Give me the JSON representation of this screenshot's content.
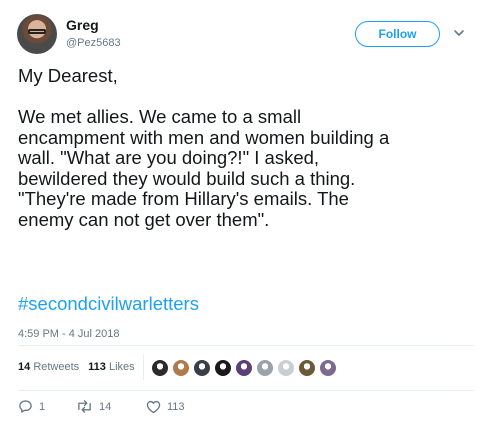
{
  "author": {
    "name": "Greg",
    "handle": "@Pez5683"
  },
  "follow_label": "Follow",
  "tweet": {
    "text": "My Dearest,\n\nWe met allies. We came to a small\nencampment with men and women building a\nwall. \"What are you doing?!\" I asked,\nbewildered they would build such a thing.\n\"They're made from Hillary's emails. The\nenemy can not get over them\".",
    "hashtag": "#secondcivilwarletters",
    "timestamp": "4:59 PM - 4 Jul 2018"
  },
  "stats": {
    "retweets_count": "14",
    "retweets_label": "Retweets",
    "likes_count": "113",
    "likes_label": "Likes"
  },
  "likers": [
    {
      "icon": "liker-avatar",
      "color": "#2b2b2b"
    },
    {
      "icon": "liker-avatar",
      "color": "#b07a4a"
    },
    {
      "icon": "liker-avatar",
      "color": "#3a3f47"
    },
    {
      "icon": "liker-avatar",
      "color": "#1a1a1a"
    },
    {
      "icon": "liker-avatar",
      "color": "#5b3f77"
    },
    {
      "icon": "liker-avatar",
      "color": "#9aa3ab"
    },
    {
      "icon": "liker-avatar",
      "color": "#c9ced3"
    },
    {
      "icon": "liker-avatar",
      "color": "#6b5a3a"
    },
    {
      "icon": "liker-avatar",
      "color": "#7d6a8c"
    }
  ],
  "actions": {
    "reply_count": "1",
    "retweet_count": "14",
    "like_count": "113"
  },
  "colors": {
    "accent": "#1da1f2",
    "text": "#14171a",
    "muted": "#657786",
    "divider": "#e6ecf0"
  }
}
